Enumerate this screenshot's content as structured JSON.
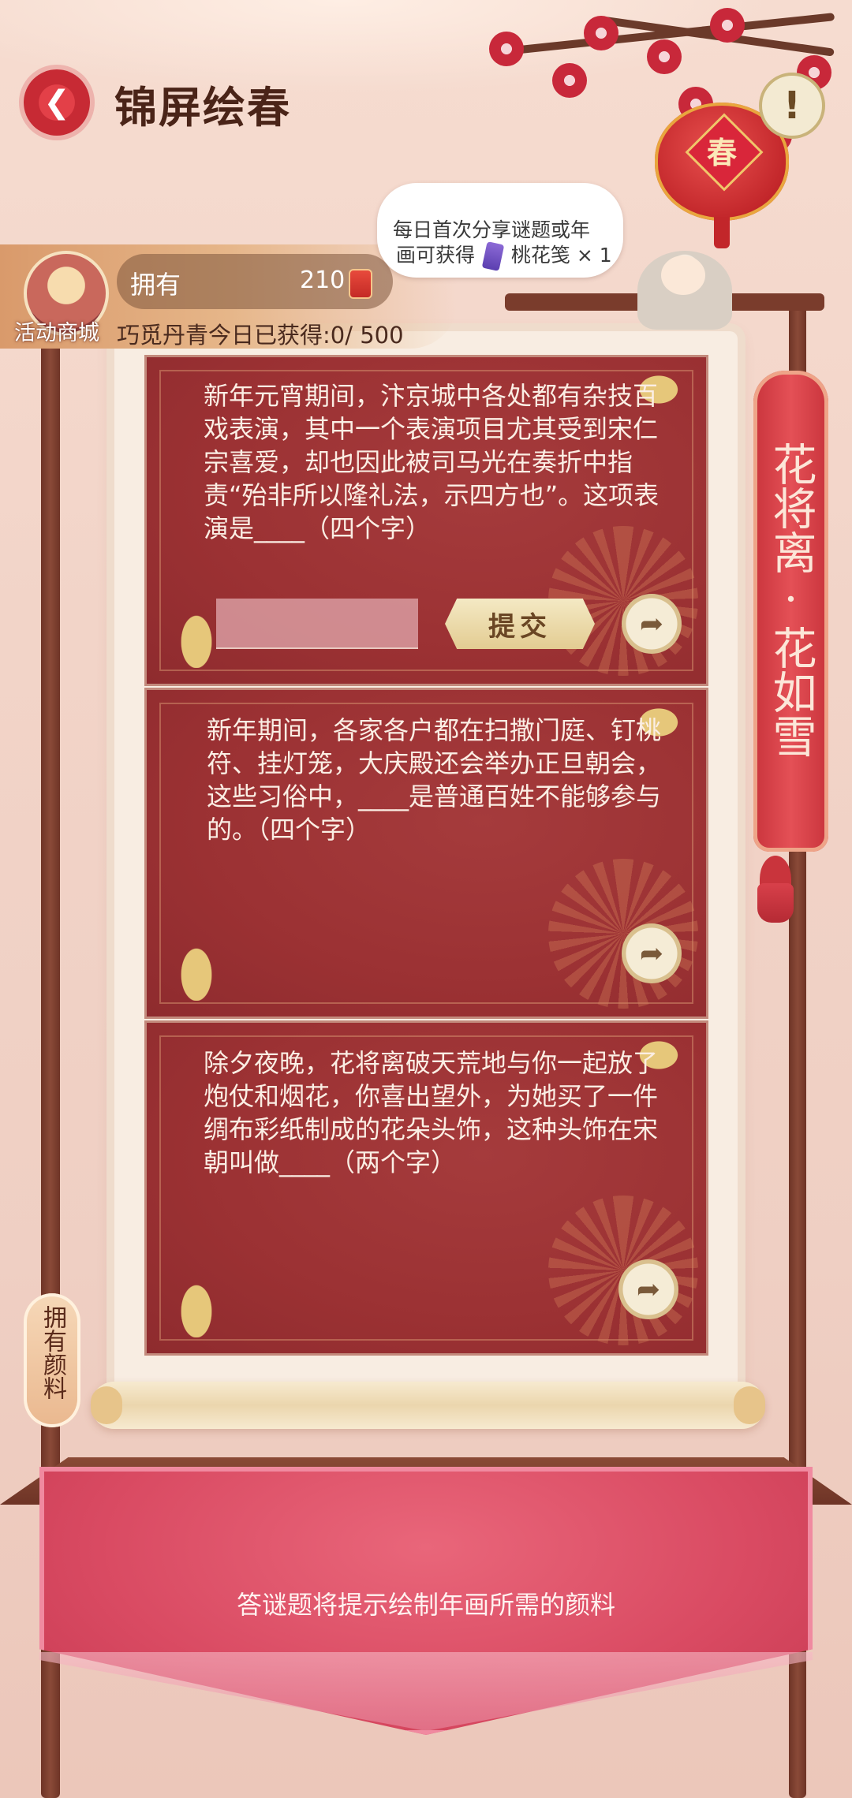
{
  "header": {
    "title": "锦屏绘春",
    "back_icon": "chevron-left-icon",
    "info_symbol": "!",
    "lantern_char": "春"
  },
  "currency": {
    "shop_label": "活动商城",
    "owned_label": "拥有",
    "owned_count": "210",
    "today_label": "巧觅丹青今日已获得:0/ 500"
  },
  "bubble": {
    "line1": "每日首次分享谜题或年",
    "line2_prefix": "画可获得",
    "line2_reward": "桃花笺 × 1"
  },
  "banner_text": "花将离·花如雪",
  "pigment_tab": "拥有颜料",
  "cards": [
    {
      "question": "新年元宵期间，汴京城中各处都有杂技百戏表演，其中一个表演项目尤其受到宋仁宗喜爱，却也因此被司马光在奏折中指责“殆非所以隆礼法，示四方也”。这项表演是____（四个字）",
      "input_value": "",
      "submit_label": "提交"
    },
    {
      "question": "新年期间，各家各户都在扫撒门庭、钉桃符、挂灯笼，大庆殿还会举办正旦朝会，这些习俗中，____是普通百姓不能够参与的。（四个字）"
    },
    {
      "question": "除夕夜晚，花将离破天荒地与你一起放了炮仗和烟花，你喜出望外，为她买了一件绸布彩纸制成的花朵头饰，这种头饰在宋朝叫做____（两个字）"
    }
  ],
  "footer_text": "答谜题将提示绘制年画所需的颜料",
  "colors": {
    "card_red": "#9b3133",
    "banner_red": "#c9343c",
    "cloth_pink": "#d94a62",
    "gold": "#e3cc92"
  }
}
